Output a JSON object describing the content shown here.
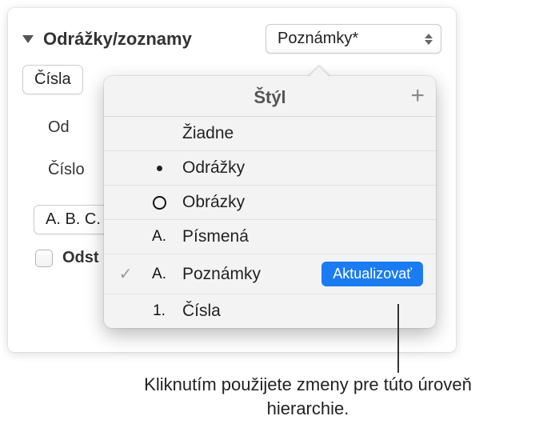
{
  "section": {
    "title": "Odrážky/zoznamy"
  },
  "stylePopup": {
    "selected": "Poznámky*"
  },
  "numbersField": "Čísla",
  "sideLabels": {
    "indent": "Od",
    "number": "Číslo"
  },
  "abcField": "A. B. C.",
  "checkbox": {
    "label": "Odst"
  },
  "popover": {
    "title": "Štýl",
    "items": [
      {
        "icon": "",
        "label": "Žiadne",
        "selected": false,
        "update": false
      },
      {
        "icon": "bullet",
        "label": "Odrážky",
        "selected": false,
        "update": false
      },
      {
        "icon": "circle",
        "label": "Obrázky",
        "selected": false,
        "update": false
      },
      {
        "icon": "A.",
        "label": "Písmená",
        "selected": false,
        "update": false
      },
      {
        "icon": "A.",
        "label": "Poznámky",
        "selected": true,
        "update": true,
        "updateLabel": "Aktualizovať"
      },
      {
        "icon": "1.",
        "label": "Čísla",
        "selected": false,
        "update": false
      }
    ]
  },
  "callout": "Kliknutím použijete zmeny pre túto úroveň hierarchie."
}
